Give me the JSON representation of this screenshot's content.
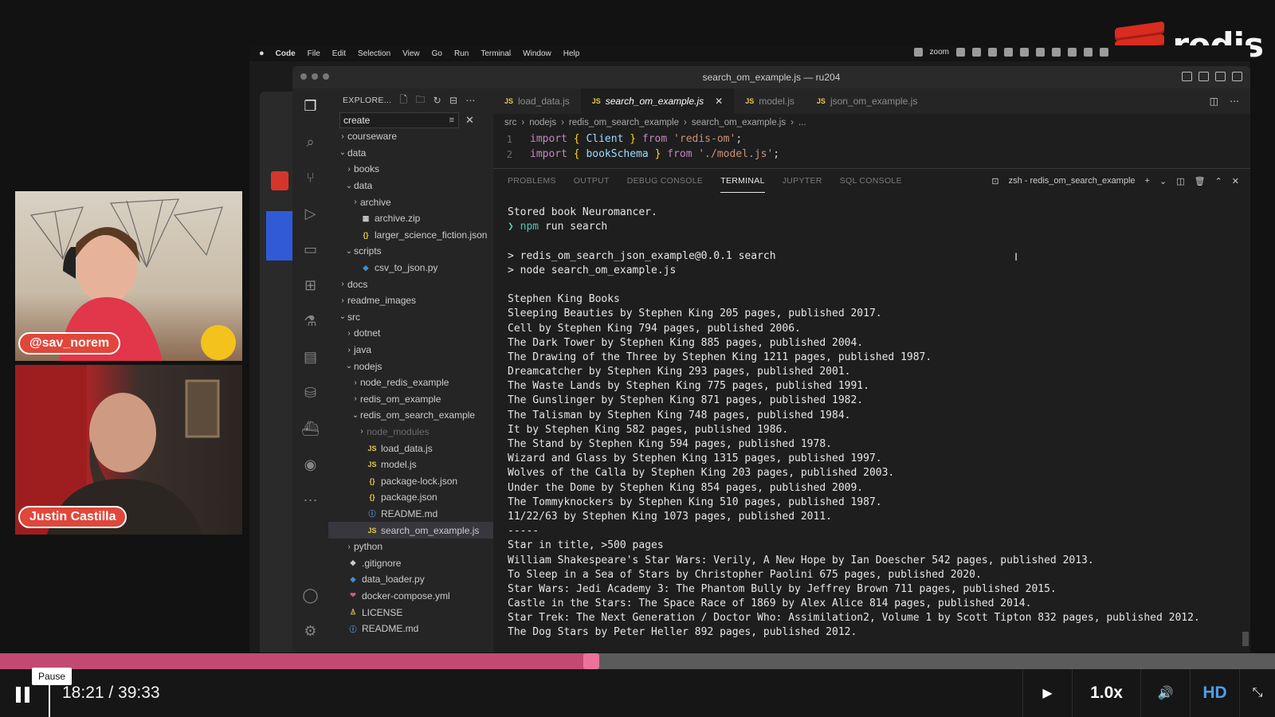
{
  "brand": {
    "logo_text": "redis"
  },
  "webcams": [
    {
      "name": "@sav_norem"
    },
    {
      "name": "Justin Castilla"
    }
  ],
  "menubar": {
    "items": [
      "Code",
      "File",
      "Edit",
      "Selection",
      "View",
      "Go",
      "Run",
      "Terminal",
      "Window",
      "Help"
    ],
    "tray_label": "zoom"
  },
  "window": {
    "title": "search_om_example.js — ru204"
  },
  "explorer": {
    "header": "EXPLORE...",
    "filter_value": "create",
    "tree": [
      {
        "label": "courseware",
        "type": "folder",
        "indent": 0,
        "open": false
      },
      {
        "label": "data",
        "type": "folder",
        "indent": 0,
        "open": true
      },
      {
        "label": "books",
        "type": "folder",
        "indent": 1,
        "open": false
      },
      {
        "label": "data",
        "type": "folder",
        "indent": 1,
        "open": true
      },
      {
        "label": "archive",
        "type": "folder",
        "indent": 2,
        "open": false
      },
      {
        "label": "archive.zip",
        "type": "zip",
        "indent": 2
      },
      {
        "label": "larger_science_fiction.json",
        "type": "json",
        "indent": 2
      },
      {
        "label": "scripts",
        "type": "folder",
        "indent": 1,
        "open": true
      },
      {
        "label": "csv_to_json.py",
        "type": "py",
        "indent": 2
      },
      {
        "label": "docs",
        "type": "folder",
        "indent": 0,
        "open": false
      },
      {
        "label": "readme_images",
        "type": "folder",
        "indent": 0,
        "open": false
      },
      {
        "label": "src",
        "type": "folder",
        "indent": 0,
        "open": true
      },
      {
        "label": "dotnet",
        "type": "folder",
        "indent": 1,
        "open": false
      },
      {
        "label": "java",
        "type": "folder",
        "indent": 1,
        "open": false
      },
      {
        "label": "nodejs",
        "type": "folder",
        "indent": 1,
        "open": true
      },
      {
        "label": "node_redis_example",
        "type": "folder",
        "indent": 2,
        "open": false
      },
      {
        "label": "redis_om_example",
        "type": "folder",
        "indent": 2,
        "open": false
      },
      {
        "label": "redis_om_search_example",
        "type": "folder",
        "indent": 2,
        "open": true
      },
      {
        "label": "node_modules",
        "type": "folder",
        "indent": 3,
        "open": false,
        "dim": true
      },
      {
        "label": "load_data.js",
        "type": "js",
        "indent": 3
      },
      {
        "label": "model.js",
        "type": "js",
        "indent": 3
      },
      {
        "label": "package-lock.json",
        "type": "json",
        "indent": 3
      },
      {
        "label": "package.json",
        "type": "json",
        "indent": 3
      },
      {
        "label": "README.md",
        "type": "info",
        "indent": 3
      },
      {
        "label": "search_om_example.js",
        "type": "js",
        "indent": 3,
        "selected": true
      },
      {
        "label": "python",
        "type": "folder",
        "indent": 1,
        "open": false
      },
      {
        "label": ".gitignore",
        "type": "git",
        "indent": 0
      },
      {
        "label": "data_loader.py",
        "type": "py",
        "indent": 0
      },
      {
        "label": "docker-compose.yml",
        "type": "docker",
        "indent": 0
      },
      {
        "label": "LICENSE",
        "type": "license",
        "indent": 0
      },
      {
        "label": "README.md",
        "type": "info",
        "indent": 0
      }
    ]
  },
  "tabs": [
    {
      "label": "load_data.js",
      "active": false
    },
    {
      "label": "search_om_example.js",
      "active": true
    },
    {
      "label": "model.js",
      "active": false
    },
    {
      "label": "json_om_example.js",
      "active": false
    }
  ],
  "breadcrumb": [
    "src",
    "nodejs",
    "redis_om_search_example",
    "search_om_example.js",
    "..."
  ],
  "code": [
    {
      "n": "1",
      "kw1": "import",
      "open": "{",
      "name": "Client",
      "close": "}",
      "kw2": "from",
      "str": "'redis-om'",
      "end": ";"
    },
    {
      "n": "2",
      "kw1": "import",
      "open": "{",
      "name": "bookSchema",
      "close": "}",
      "kw2": "from",
      "str": "'./model.js'",
      "end": ";"
    }
  ],
  "panel": {
    "tabs": [
      "PROBLEMS",
      "OUTPUT",
      "DEBUG CONSOLE",
      "TERMINAL",
      "JUPYTER",
      "SQL CONSOLE"
    ],
    "active_tab": "TERMINAL",
    "shell_label": "zsh - redis_om_search_example"
  },
  "terminal": {
    "lines": [
      "Stored book Neuromancer.",
      "❯ npm run search",
      "",
      "> redis_om_search_json_example@0.0.1 search",
      "> node search_om_example.js",
      "",
      "Stephen King Books",
      "Sleeping Beauties by Stephen King 205 pages, published 2017.",
      "Cell by Stephen King 794 pages, published 2006.",
      "The Dark Tower by Stephen King 885 pages, published 2004.",
      "The Drawing of the Three by Stephen King 1211 pages, published 1987.",
      "Dreamcatcher by Stephen King 293 pages, published 2001.",
      "The Waste Lands by Stephen King 775 pages, published 1991.",
      "The Gunslinger by Stephen King 871 pages, published 1982.",
      "The Talisman by Stephen King 748 pages, published 1984.",
      "It by Stephen King 582 pages, published 1986.",
      "The Stand by Stephen King 594 pages, published 1978.",
      "Wizard and Glass by Stephen King 1315 pages, published 1997.",
      "Wolves of the Calla by Stephen King 203 pages, published 2003.",
      "Under the Dome by Stephen King 854 pages, published 2009.",
      "The Tommyknockers by Stephen King 510 pages, published 1987.",
      "11/22/63 by Stephen King 1073 pages, published 2011.",
      "-----",
      "Star in title, >500 pages",
      "William Shakespeare's Star Wars: Verily, A New Hope by Ian Doescher 542 pages, published 2013.",
      "To Sleep in a Sea of Stars by Christopher Paolini 675 pages, published 2020.",
      "Star Wars: Jedi Academy 3: The Phantom Bully by Jeffrey Brown 711 pages, published 2015.",
      "Castle in the Stars: The Space Race of 1869 by Alex Alice 814 pages, published 2014.",
      "Star Trek: The Next Generation / Doctor Who: Assimilation2, Volume 1 by Scott Tipton 832 pages, published 2012.",
      "The Dog Stars by Peter Heller 892 pages, published 2012."
    ]
  },
  "player": {
    "tooltip": "Pause",
    "time_display": "18:21 / 39:33",
    "progress_fraction": 0.464,
    "speed": "1.0x",
    "quality": "HD",
    "colors": {
      "played": "#c24a72",
      "knob": "#e9739a",
      "hd": "#4f9ee8"
    }
  }
}
